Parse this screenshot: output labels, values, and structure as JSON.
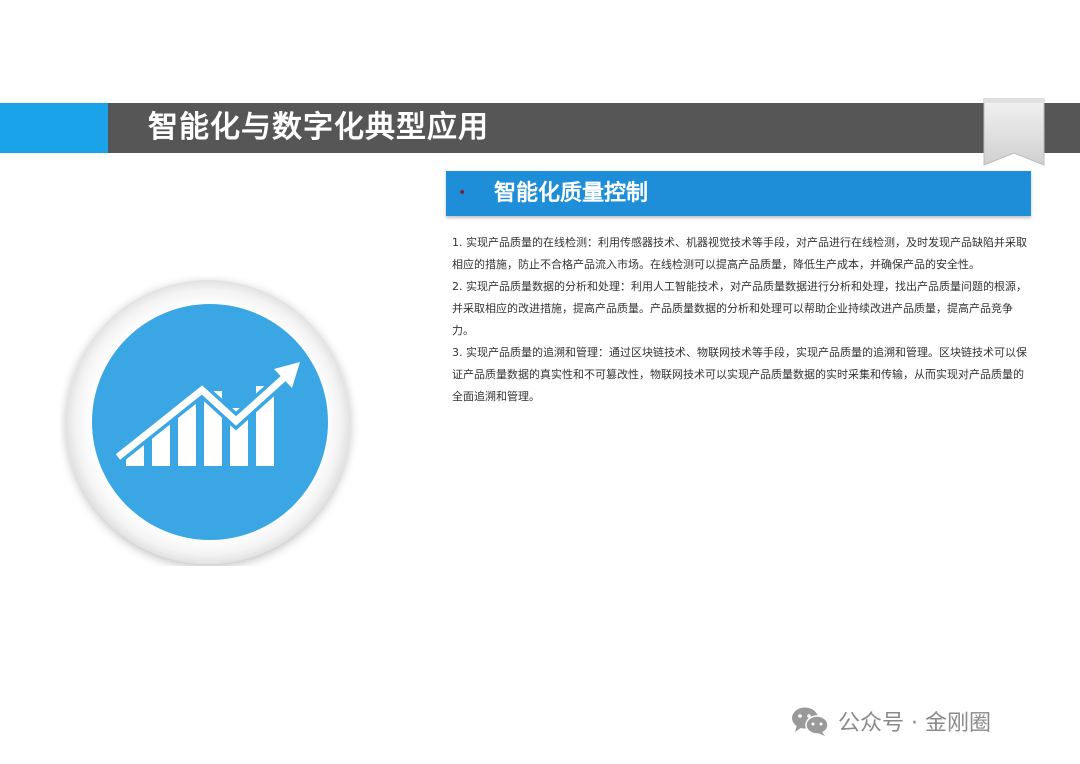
{
  "header": {
    "title": "智能化与数字化典型应用"
  },
  "section": {
    "bullet": "•",
    "title": "智能化质量控制"
  },
  "paragraphs": [
    "1. 实现产品质量的在线检测：利用传感器技术、机器视觉技术等手段，对产品进行在线检测，及时发现产品缺陷并采取相应的措施，防止不合格产品流入市场。在线检测可以提高产品质量，降低生产成本，并确保产品的安全性。",
    "2. 实现产品质量数据的分析和处理：利用人工智能技术，对产品质量数据进行分析和处理，找出产品质量问题的根源，并采取相应的改进措施，提高产品质量。产品质量数据的分析和处理可以帮助企业持续改进产品质量，提高产品竞争力。",
    "3. 实现产品质量的追溯和管理：通过区块链技术、物联网技术等手段，实现产品质量的追溯和管理。区块链技术可以保证产品质量数据的真实性和不可篡改性，物联网技术可以实现产品质量数据的实时采集和传输，从而实现对产品质量的全面追溯和管理。"
  ],
  "watermark": {
    "text": "公众号 · 金刚圈"
  },
  "colors": {
    "accent_blue": "#1aa3e8",
    "header_gray": "#565656",
    "section_blue": "#1e8ed8",
    "circle_blue": "#3aa6e3"
  },
  "icons": {
    "illustration": "chart-growth-icon",
    "bookmark": "bookmark-ribbon-icon",
    "watermark": "wechat-icon"
  }
}
